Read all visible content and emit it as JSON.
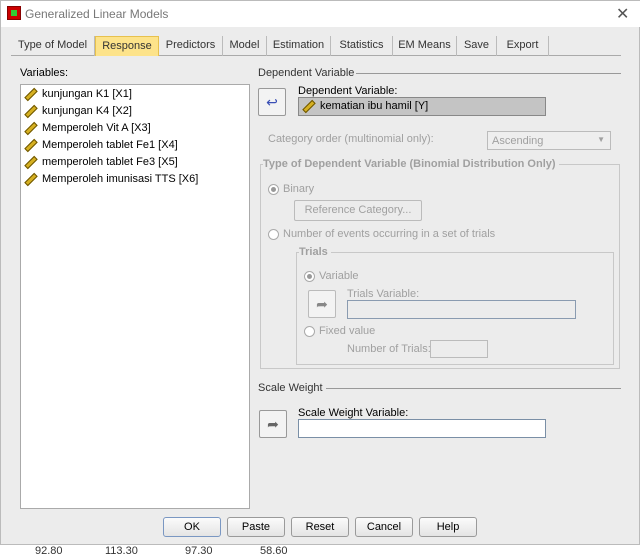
{
  "window": {
    "title": "Generalized Linear Models",
    "close_icon": "close-icon"
  },
  "tabs": [
    "Type of Model",
    "Response",
    "Predictors",
    "Model",
    "Estimation",
    "Statistics",
    "EM Means",
    "Save",
    "Export"
  ],
  "active_tab": "Response",
  "variables": {
    "label": "Variables:",
    "items": [
      "kunjungan K1 [X1]",
      "kunjungan K4 [X2]",
      "Memperoleh Vit A [X3]",
      "Memperoleh tablet Fe1 [X4]",
      "memperoleh tablet Fe3 [X5]",
      "Memperoleh imunisasi TTS [X6]"
    ]
  },
  "dependent": {
    "section": "Dependent Variable",
    "field_label": "Dependent Variable:",
    "value": "kematian ibu hamil [Y]",
    "category_order_label": "Category order (multinomial only):",
    "category_order_value": "Ascending"
  },
  "type_group": {
    "title": "Type of Dependent Variable (Binomial Distribution Only)",
    "binary": "Binary",
    "reference_category": "Reference Category...",
    "events": "Number of events occurring in a set of trials",
    "trials": {
      "title": "Trials",
      "variable": "Variable",
      "trials_variable_label": "Trials Variable:",
      "fixed": "Fixed value",
      "number_label": "Number of Trials:"
    }
  },
  "scale_weight": {
    "section": "Scale Weight",
    "field_label": "Scale Weight Variable:",
    "value": ""
  },
  "buttons": {
    "ok": "OK",
    "paste": "Paste",
    "reset": "Reset",
    "cancel": "Cancel",
    "help": "Help"
  },
  "background_values": [
    "92.80",
    "113.30",
    "97.30",
    "58.60"
  ]
}
